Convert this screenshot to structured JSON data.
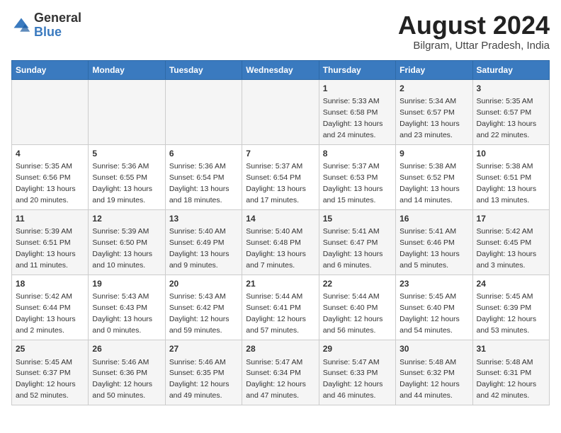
{
  "header": {
    "logo_general": "General",
    "logo_blue": "Blue",
    "month_title": "August 2024",
    "subtitle": "Bilgram, Uttar Pradesh, India"
  },
  "days_of_week": [
    "Sunday",
    "Monday",
    "Tuesday",
    "Wednesday",
    "Thursday",
    "Friday",
    "Saturday"
  ],
  "weeks": [
    [
      {
        "day": "",
        "info": ""
      },
      {
        "day": "",
        "info": ""
      },
      {
        "day": "",
        "info": ""
      },
      {
        "day": "",
        "info": ""
      },
      {
        "day": "1",
        "info": "Sunrise: 5:33 AM\nSunset: 6:58 PM\nDaylight: 13 hours and 24 minutes."
      },
      {
        "day": "2",
        "info": "Sunrise: 5:34 AM\nSunset: 6:57 PM\nDaylight: 13 hours and 23 minutes."
      },
      {
        "day": "3",
        "info": "Sunrise: 5:35 AM\nSunset: 6:57 PM\nDaylight: 13 hours and 22 minutes."
      }
    ],
    [
      {
        "day": "4",
        "info": "Sunrise: 5:35 AM\nSunset: 6:56 PM\nDaylight: 13 hours and 20 minutes."
      },
      {
        "day": "5",
        "info": "Sunrise: 5:36 AM\nSunset: 6:55 PM\nDaylight: 13 hours and 19 minutes."
      },
      {
        "day": "6",
        "info": "Sunrise: 5:36 AM\nSunset: 6:54 PM\nDaylight: 13 hours and 18 minutes."
      },
      {
        "day": "7",
        "info": "Sunrise: 5:37 AM\nSunset: 6:54 PM\nDaylight: 13 hours and 17 minutes."
      },
      {
        "day": "8",
        "info": "Sunrise: 5:37 AM\nSunset: 6:53 PM\nDaylight: 13 hours and 15 minutes."
      },
      {
        "day": "9",
        "info": "Sunrise: 5:38 AM\nSunset: 6:52 PM\nDaylight: 13 hours and 14 minutes."
      },
      {
        "day": "10",
        "info": "Sunrise: 5:38 AM\nSunset: 6:51 PM\nDaylight: 13 hours and 13 minutes."
      }
    ],
    [
      {
        "day": "11",
        "info": "Sunrise: 5:39 AM\nSunset: 6:51 PM\nDaylight: 13 hours and 11 minutes."
      },
      {
        "day": "12",
        "info": "Sunrise: 5:39 AM\nSunset: 6:50 PM\nDaylight: 13 hours and 10 minutes."
      },
      {
        "day": "13",
        "info": "Sunrise: 5:40 AM\nSunset: 6:49 PM\nDaylight: 13 hours and 9 minutes."
      },
      {
        "day": "14",
        "info": "Sunrise: 5:40 AM\nSunset: 6:48 PM\nDaylight: 13 hours and 7 minutes."
      },
      {
        "day": "15",
        "info": "Sunrise: 5:41 AM\nSunset: 6:47 PM\nDaylight: 13 hours and 6 minutes."
      },
      {
        "day": "16",
        "info": "Sunrise: 5:41 AM\nSunset: 6:46 PM\nDaylight: 13 hours and 5 minutes."
      },
      {
        "day": "17",
        "info": "Sunrise: 5:42 AM\nSunset: 6:45 PM\nDaylight: 13 hours and 3 minutes."
      }
    ],
    [
      {
        "day": "18",
        "info": "Sunrise: 5:42 AM\nSunset: 6:44 PM\nDaylight: 13 hours and 2 minutes."
      },
      {
        "day": "19",
        "info": "Sunrise: 5:43 AM\nSunset: 6:43 PM\nDaylight: 13 hours and 0 minutes."
      },
      {
        "day": "20",
        "info": "Sunrise: 5:43 AM\nSunset: 6:42 PM\nDaylight: 12 hours and 59 minutes."
      },
      {
        "day": "21",
        "info": "Sunrise: 5:44 AM\nSunset: 6:41 PM\nDaylight: 12 hours and 57 minutes."
      },
      {
        "day": "22",
        "info": "Sunrise: 5:44 AM\nSunset: 6:40 PM\nDaylight: 12 hours and 56 minutes."
      },
      {
        "day": "23",
        "info": "Sunrise: 5:45 AM\nSunset: 6:40 PM\nDaylight: 12 hours and 54 minutes."
      },
      {
        "day": "24",
        "info": "Sunrise: 5:45 AM\nSunset: 6:39 PM\nDaylight: 12 hours and 53 minutes."
      }
    ],
    [
      {
        "day": "25",
        "info": "Sunrise: 5:45 AM\nSunset: 6:37 PM\nDaylight: 12 hours and 52 minutes."
      },
      {
        "day": "26",
        "info": "Sunrise: 5:46 AM\nSunset: 6:36 PM\nDaylight: 12 hours and 50 minutes."
      },
      {
        "day": "27",
        "info": "Sunrise: 5:46 AM\nSunset: 6:35 PM\nDaylight: 12 hours and 49 minutes."
      },
      {
        "day": "28",
        "info": "Sunrise: 5:47 AM\nSunset: 6:34 PM\nDaylight: 12 hours and 47 minutes."
      },
      {
        "day": "29",
        "info": "Sunrise: 5:47 AM\nSunset: 6:33 PM\nDaylight: 12 hours and 46 minutes."
      },
      {
        "day": "30",
        "info": "Sunrise: 5:48 AM\nSunset: 6:32 PM\nDaylight: 12 hours and 44 minutes."
      },
      {
        "day": "31",
        "info": "Sunrise: 5:48 AM\nSunset: 6:31 PM\nDaylight: 12 hours and 42 minutes."
      }
    ]
  ]
}
